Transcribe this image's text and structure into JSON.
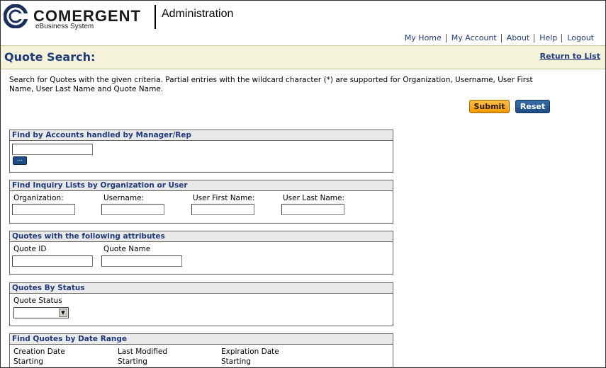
{
  "header": {
    "logo_word": "COMERGENT",
    "logo_sub": "eBusiness System",
    "app_title": "Administration",
    "nav": [
      "My Home",
      "My Account",
      "About",
      "Help",
      "Logout"
    ]
  },
  "page": {
    "title": "Quote Search:",
    "return_link": "Return to List",
    "description": "Search for Quotes with the given criteria. Partial entries with the wildcard character (*) are supported for Organization, Username, User First Name, User Last Name and Quote Name."
  },
  "buttons": {
    "submit": "Submit",
    "reset": "Reset",
    "browse": "..."
  },
  "sections": {
    "accounts": {
      "title": "Find by Accounts handled by Manager/Rep"
    },
    "inquiry": {
      "title": "Find Inquiry Lists by Organization or User",
      "labels": [
        "Organization:",
        "Username:",
        "User First Name:",
        "User Last Name:"
      ]
    },
    "attributes": {
      "title": "Quotes with the following attributes",
      "labels": [
        "Quote ID",
        "Quote Name"
      ]
    },
    "status": {
      "title": "Quotes By Status",
      "label": "Quote Status",
      "selected": ""
    },
    "dates": {
      "title": "Find Quotes by Date Range",
      "labels": [
        "Creation Date",
        "Last Modified",
        "Expiration Date"
      ],
      "sub_labels": [
        "Starting",
        "Starting",
        "Starting"
      ]
    }
  },
  "colors": {
    "brand_blue": "#1f3a7a",
    "title_bar": "#f4f2d8",
    "submit": "#f29b00",
    "reset": "#1e4c86"
  }
}
